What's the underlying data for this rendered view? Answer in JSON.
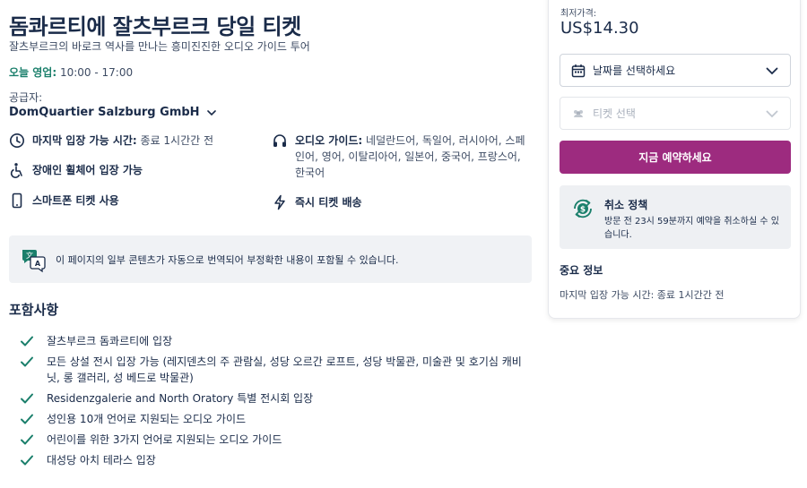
{
  "product": {
    "title": "돔콰르티에 잘츠부르크 당일 티켓",
    "subtitle": "잘츠부르크의 바로크 역사를 만나는 흥미진진한 오디오 가이드 투어",
    "hours_label": "오늘 영업:",
    "hours_value": "10:00 - 17:00",
    "supplier_label": "공급자:",
    "supplier_name": "DomQuartier Salzburg GmbH"
  },
  "features": {
    "last_entry_label": "마지막 입장 가능 시간:",
    "last_entry_value": "종료 1시간간 전",
    "audio_label": "오디오 가이드:",
    "audio_value": "네덜란드어, 독일어, 러시아어, 스페인어, 영어, 이탈리아어, 일본어, 중국어, 프랑스어, 한국어",
    "wheelchair": "장애인 휠체어 입장 가능",
    "mobile_ticket": "스마트폰 티켓 사용",
    "instant": "즉시 티켓 배송"
  },
  "notice": {
    "text": "이 페이지의 일부 콘텐츠가 자동으로 번역되어 부정확한 내용이 포함될 수 있습니다."
  },
  "inclusions": {
    "title": "포함사항",
    "items": [
      "잘츠부르크 돔콰르티에 입장",
      "모든 상설 전시 입장 가능 (레지덴츠의 주 관람실, 성당 오르간 로프트, 성당 박물관, 미술관 및 호기심 캐비닛, 롱 갤러리, 성 베드로 박물관)",
      "Residenzgalerie and North Oratory 특별 전시회 입장",
      "성인용 10개 언어로 지원되는 오디오 가이드",
      "어린이를 위한 3가지 언어로 지원되는 오디오 가이드",
      "대성당 아치 테라스 입장"
    ]
  },
  "booking": {
    "price_label": "최저가격:",
    "price": "US$14.30",
    "date_placeholder": "날짜를 선택하세요",
    "ticket_placeholder": "티켓 선택",
    "book_button": "지금 예약하세요",
    "cancel_title": "취소 정책",
    "cancel_text": "방문 전 23시 59분까지 예약을 취소하실 수 있습니다.",
    "important_title": "중요 정보",
    "important_text": "마지막 입장 가능 시간: 종료 1시간간 전"
  },
  "colors": {
    "primary_text": "#1a2b49",
    "accent_green": "#1a7f6b",
    "book_button": "#9d2b7f"
  }
}
